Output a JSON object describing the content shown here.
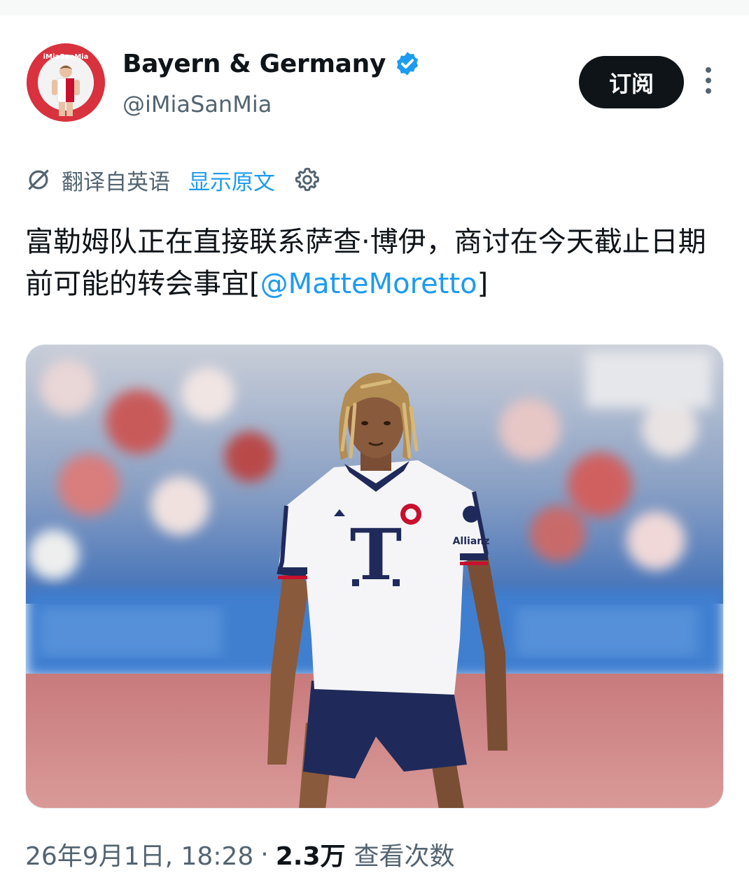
{
  "account": {
    "display_name": "Bayern & Germany",
    "handle": "@iMiaSanMia",
    "avatar_text": "iMiaSanMia"
  },
  "actions": {
    "subscribe_label": "订阅"
  },
  "translation": {
    "translated_from": "翻译自英语",
    "show_original": "显示原文"
  },
  "tweet": {
    "text_before_mention": "富勒姆队正在直接联系萨查·博伊，商讨在今天截止日期前可能的转会事宜[",
    "mention": "@MatteMoretto",
    "text_after_mention": "]"
  },
  "photo": {
    "shirt_logo": "T",
    "sleeve_sponsor": "Allianz"
  },
  "meta": {
    "timestamp": "26年9月1日, 18:28",
    "separator": "·",
    "views_count": "2.3万",
    "views_label": "查看次数"
  },
  "colors": {
    "link": "#1d9bf0",
    "text": "#0f1419",
    "secondary": "#536471",
    "verified": "#1d9bf0"
  },
  "icons": [
    "verified-badge-icon",
    "more-options-icon",
    "translate-icon",
    "gear-icon"
  ]
}
